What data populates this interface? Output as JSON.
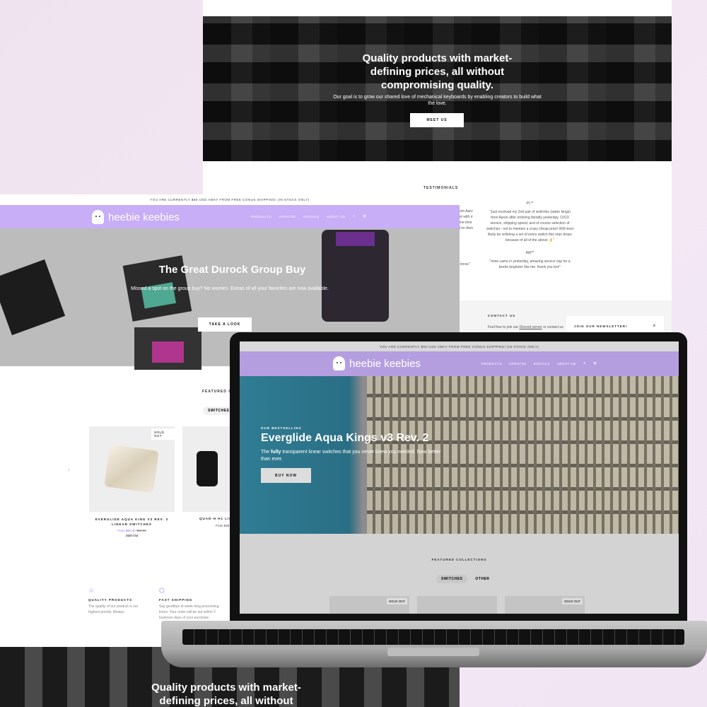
{
  "back_page": {
    "hero": {
      "title": "Quality products with market-defining prices, all without compromising quality.",
      "subtitle": "Our goal is to grow our shared love of mechanical keyboards by enabling creators to build what the love.",
      "button": "MEET US"
    },
    "testimonials": {
      "heading": "TESTIMONIALS",
      "partial": [
        "from Aaron.",
        "ent with my",
        "ome time to",
        "id on them",
        "know.\""
      ],
      "items": [
        {
          "author": "PL**",
          "quote": "\"Just received my 2nd pair of switches (water kings) from Aaron after ordering literally yesterday. 10/10 service, shipping speed, and of course selection of switches - not to mention a crazy cheap price! Will most likely be ordering a set of every switch this man drops because of all of the above 👌\""
        },
        {
          "author": "AW**",
          "quote": "\"mine came in yesterday, amazing service esp for a keebs beginner like me. thank you bro!\""
        }
      ]
    },
    "contact": {
      "heading": "CONTACT US",
      "text_before": "Feel free to join our ",
      "link": "Discord server",
      "text_after": " or contact us"
    },
    "newsletter": {
      "title": "JOIN OUR NEWSLETTER!",
      "close": "×"
    }
  },
  "left_page": {
    "announcement": "YOU ARE CURRENTLY $68 USD AWAY FROM FREE CONUS SHIPPING! (IN-STOCK ONLY)",
    "brand": "heebie keebies",
    "nav": [
      "PRODUCTS",
      "UPDATES",
      "SOCIALS",
      "ABOUT US"
    ],
    "hero": {
      "title": "The Great Durock Group Buy",
      "subtitle": "Missed a spot on the group buy? No worries. Extras of all your favorites are now available.",
      "button": "TAKE A LOOK"
    },
    "featured": {
      "heading": "FEATURED COLLECTIONS",
      "tabs": [
        "SWITCHES"
      ]
    },
    "products": [
      {
        "badge": "SOLD OUT",
        "name": "EVERGLIDE AQUA KING V3 REV. 2 LINEAR SWITCHES",
        "price": "From $50.40",
        "compare": "$52.50",
        "status": "Sold Out"
      },
      {
        "name": "QUAD-H H1 LINEAR",
        "price": "From $45"
      }
    ],
    "features": [
      {
        "title": "QUALITY PRODUCTS",
        "text": "The quality of our product is our highest priority. Always."
      },
      {
        "title": "FAST SHIPPING",
        "text": "Say goodbye to week-long processing times. Your order will be out within 2 business days of your purchase."
      }
    ],
    "bottom_hero": "Quality products with market-defining prices, all without"
  },
  "laptop": {
    "announcement": "YOU ARE CURRENTLY $68 USD AWAY FROM FREE CONUS SHIPPING! (IN-STOCK ONLY)",
    "brand": "heebie keebies",
    "nav": [
      "PRODUCTS",
      "UPDATES",
      "SOCIALS",
      "ABOUT US"
    ],
    "hero": {
      "eyebrow": "OUR BESTSELLING",
      "title": "Everglide Aqua Kings v3 Rev. 2",
      "subtitle_bold": "fully",
      "subtitle_pre": "The ",
      "subtitle_post": " transparent linear switches that you never knew you needed. Now better than ever.",
      "button": "BUY NOW"
    },
    "featured": {
      "heading": "FEATURED COLLECTIONS",
      "tabs": [
        "SWITCHES",
        "OTHER"
      ]
    },
    "cards": [
      {
        "badge": "SOLD OUT"
      },
      {
        "badge": ""
      },
      {
        "badge": "SOLD OUT"
      }
    ]
  },
  "colors": {
    "nav_purple": "#c8adf7",
    "laptop_nav": "#b59ee0",
    "hero_teal": "#2f7d94",
    "price_purple": "#9b6cf0"
  }
}
